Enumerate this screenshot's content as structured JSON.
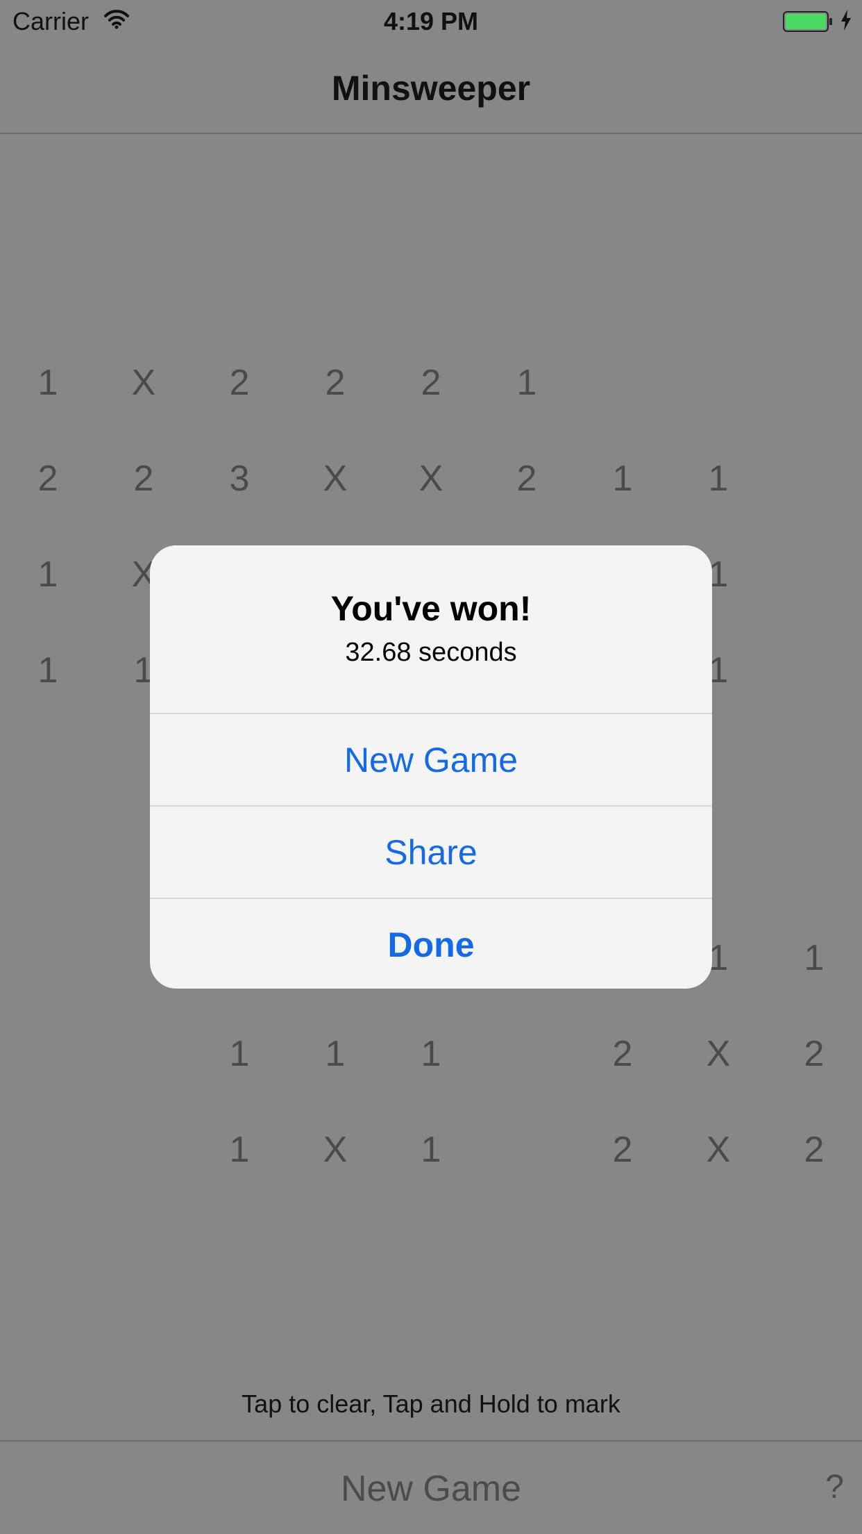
{
  "status_bar": {
    "carrier": "Carrier",
    "time": "4:19 PM",
    "battery_color": "#4cd964"
  },
  "nav": {
    "title": "Minsweeper"
  },
  "board": {
    "rows": [
      [
        "1",
        "X",
        "2",
        "2",
        "2",
        "1",
        "",
        "",
        ""
      ],
      [
        "2",
        "2",
        "3",
        "X",
        "X",
        "2",
        "1",
        "1",
        ""
      ],
      [
        "1",
        "X",
        "",
        "",
        "",
        "",
        "",
        "1",
        ""
      ],
      [
        "1",
        "1",
        "",
        "",
        "",
        "",
        "",
        "1",
        ""
      ],
      [
        "",
        "",
        "",
        "",
        "",
        "",
        "",
        "",
        ""
      ],
      [
        "",
        "",
        "",
        "",
        "",
        "",
        "",
        "",
        ""
      ],
      [
        "",
        "",
        "",
        "",
        "",
        "",
        "",
        "1",
        "1"
      ],
      [
        "",
        "",
        "1",
        "1",
        "1",
        "",
        "2",
        "X",
        "2"
      ],
      [
        "",
        "",
        "1",
        "X",
        "1",
        "",
        "2",
        "X",
        "2"
      ]
    ]
  },
  "hint": "Tap to clear, Tap and Hold to mark",
  "toolbar": {
    "new_game_label": "New Game",
    "help_label": "?"
  },
  "alert": {
    "title": "You've won!",
    "message": "32.68 seconds",
    "buttons": [
      {
        "label": "New Game"
      },
      {
        "label": "Share"
      },
      {
        "label": "Done"
      }
    ],
    "accent_color": "#1369e6"
  }
}
